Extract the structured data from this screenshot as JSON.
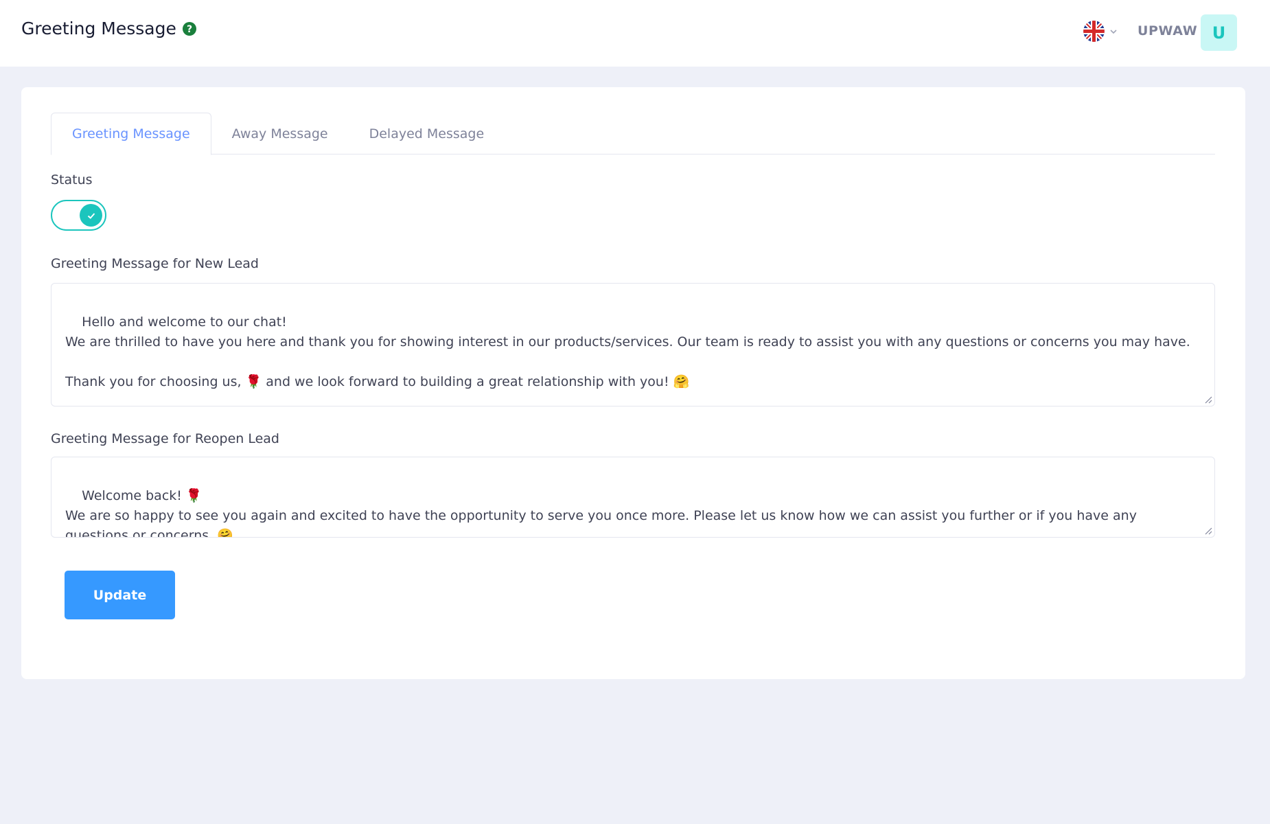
{
  "header": {
    "title": "Greeting Message",
    "help_icon": "question-circle-icon",
    "language_icon": "uk-flag-icon",
    "username": "UPWAW",
    "avatar_initial": "U"
  },
  "tabs": [
    {
      "label": "Greeting Message",
      "active": true
    },
    {
      "label": "Away Message",
      "active": false
    },
    {
      "label": "Delayed Message",
      "active": false
    }
  ],
  "form": {
    "status_label": "Status",
    "status_on": true,
    "new_lead_label": "Greeting Message for New Lead",
    "new_lead_value": "Hello and welcome to our chat!\nWe are thrilled to have you here and thank you for showing interest in our products/services. Our team is ready to assist you with any questions or concerns you may have.\n\nThank you for choosing us, 🌹 and we look forward to building a great relationship with you! 🤗",
    "reopen_lead_label": "Greeting Message for Reopen Lead",
    "reopen_lead_value": "Welcome back! 🌹\nWe are so happy to see you again and excited to have the opportunity to serve you once more. Please let us know how we can assist you further or if you have any questions or concerns. 🤗",
    "update_label": "Update"
  },
  "colors": {
    "accent": "#3699ff",
    "toggle": "#1bc5bd",
    "active_tab": "#6993ff"
  }
}
